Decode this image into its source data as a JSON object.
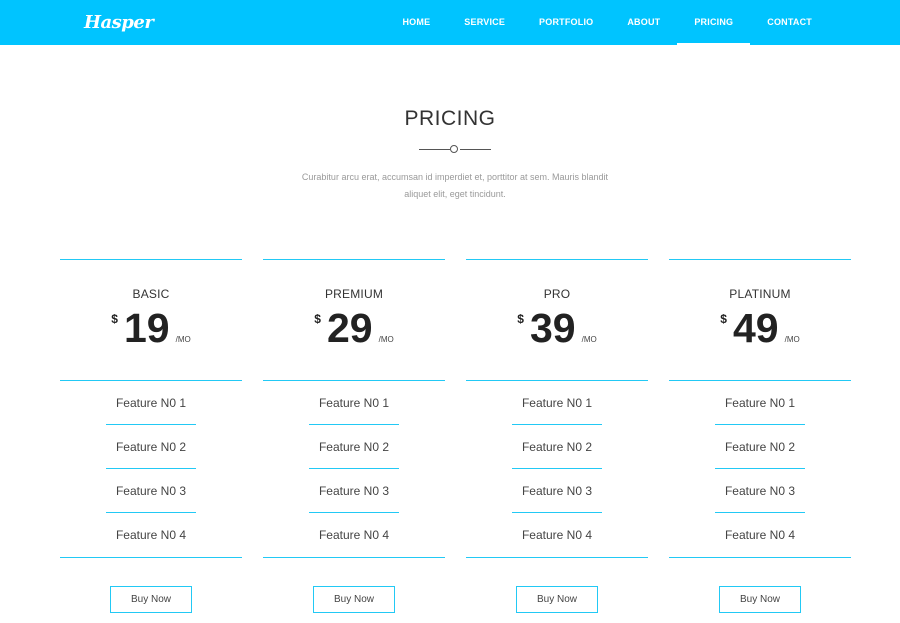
{
  "header": {
    "logo": "Hasper",
    "nav": [
      {
        "label": "HOME",
        "active": false
      },
      {
        "label": "SERVICE",
        "active": false
      },
      {
        "label": "PORTFOLIO",
        "active": false
      },
      {
        "label": "ABOUT",
        "active": false
      },
      {
        "label": "PRICING",
        "active": true
      },
      {
        "label": "CONTACT",
        "active": false
      }
    ]
  },
  "section": {
    "title": "PRICING",
    "description": "Curabitur arcu erat, accumsan id imperdiet et, porttitor at sem. Mauris blandit aliquet elit, eget tincidunt."
  },
  "plans": [
    {
      "name": "BASIC",
      "currency": "$",
      "price": "19",
      "period": "/MO",
      "features": [
        "Feature N0 1",
        "Feature N0 2",
        "Feature N0 3",
        "Feature N0 4"
      ],
      "button": "Buy Now"
    },
    {
      "name": "PREMIUM",
      "currency": "$",
      "price": "29",
      "period": "/MO",
      "features": [
        "Feature N0 1",
        "Feature N0 2",
        "Feature N0 3",
        "Feature N0 4"
      ],
      "button": "Buy Now"
    },
    {
      "name": "PRO",
      "currency": "$",
      "price": "39",
      "period": "/MO",
      "features": [
        "Feature N0 1",
        "Feature N0 2",
        "Feature N0 3",
        "Feature N0 4"
      ],
      "button": "Buy Now"
    },
    {
      "name": "PLATINUM",
      "currency": "$",
      "price": "49",
      "period": "/MO",
      "features": [
        "Feature N0 1",
        "Feature N0 2",
        "Feature N0 3",
        "Feature N0 4"
      ],
      "button": "Buy Now"
    }
  ],
  "colors": {
    "brand": "#00c4ff",
    "accent_line": "#22c9f5",
    "text_dark": "#222222",
    "text_muted": "#9a9a9a",
    "background": "#ffffff"
  }
}
